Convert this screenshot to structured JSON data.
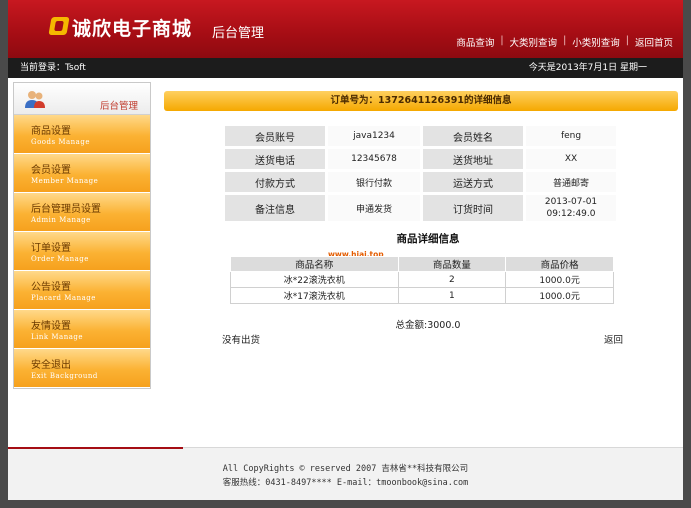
{
  "header": {
    "brand": "诚欣电子商城",
    "subtitle": "后台管理",
    "nav": [
      "商品查询",
      "大类别查询",
      "小类别查询",
      "返回首页"
    ]
  },
  "bar": {
    "login": "当前登录：Tsoft",
    "date": "今天是2013年7月1日 星期一"
  },
  "sidebar": {
    "title": "后台管理",
    "items": [
      {
        "cn": "商品设置",
        "en": "Goods Manage"
      },
      {
        "cn": "会员设置",
        "en": "Member Manage"
      },
      {
        "cn": "后台管理员设置",
        "en": "Admin Manage"
      },
      {
        "cn": "订单设置",
        "en": "Order Manage"
      },
      {
        "cn": "公告设置",
        "en": "Placard Manage"
      },
      {
        "cn": "友情设置",
        "en": "Link Manage"
      },
      {
        "cn": "安全退出",
        "en": "Exit Background"
      }
    ]
  },
  "order": {
    "title": "订单号为：1372641126391的详细信息",
    "rows": [
      [
        "会员账号",
        "java1234",
        "会员姓名",
        "feng"
      ],
      [
        "送货电话",
        "12345678",
        "送货地址",
        "XX"
      ],
      [
        "付款方式",
        "银行付款",
        "运送方式",
        "普通邮寄"
      ],
      [
        "备注信息",
        "申通发货",
        "订货时间",
        "2013-07-01\n09:12:49.0"
      ]
    ]
  },
  "items": {
    "section_title": "商品详细信息",
    "watermark": "www.hiai.top",
    "headers": [
      "商品名称",
      "商品数量",
      "商品价格"
    ],
    "rows": [
      [
        "冰*22滚洗衣机",
        "2",
        "1000.0元"
      ],
      [
        "冰*17滚洗衣机",
        "1",
        "1000.0元"
      ]
    ],
    "total": "总金额:3000.0",
    "status": "没有出货",
    "back": "返回"
  },
  "footer": {
    "line1": "All CopyRights © reserved 2007 吉林省**科技有限公司",
    "line2": "客服热线：0431-8497**** E-mail：tmoonbook@sina.com"
  },
  "colors": {
    "header_red": "#a50d14",
    "menu_orange": "#f6a11d",
    "bar_black": "#1c1c1c"
  }
}
